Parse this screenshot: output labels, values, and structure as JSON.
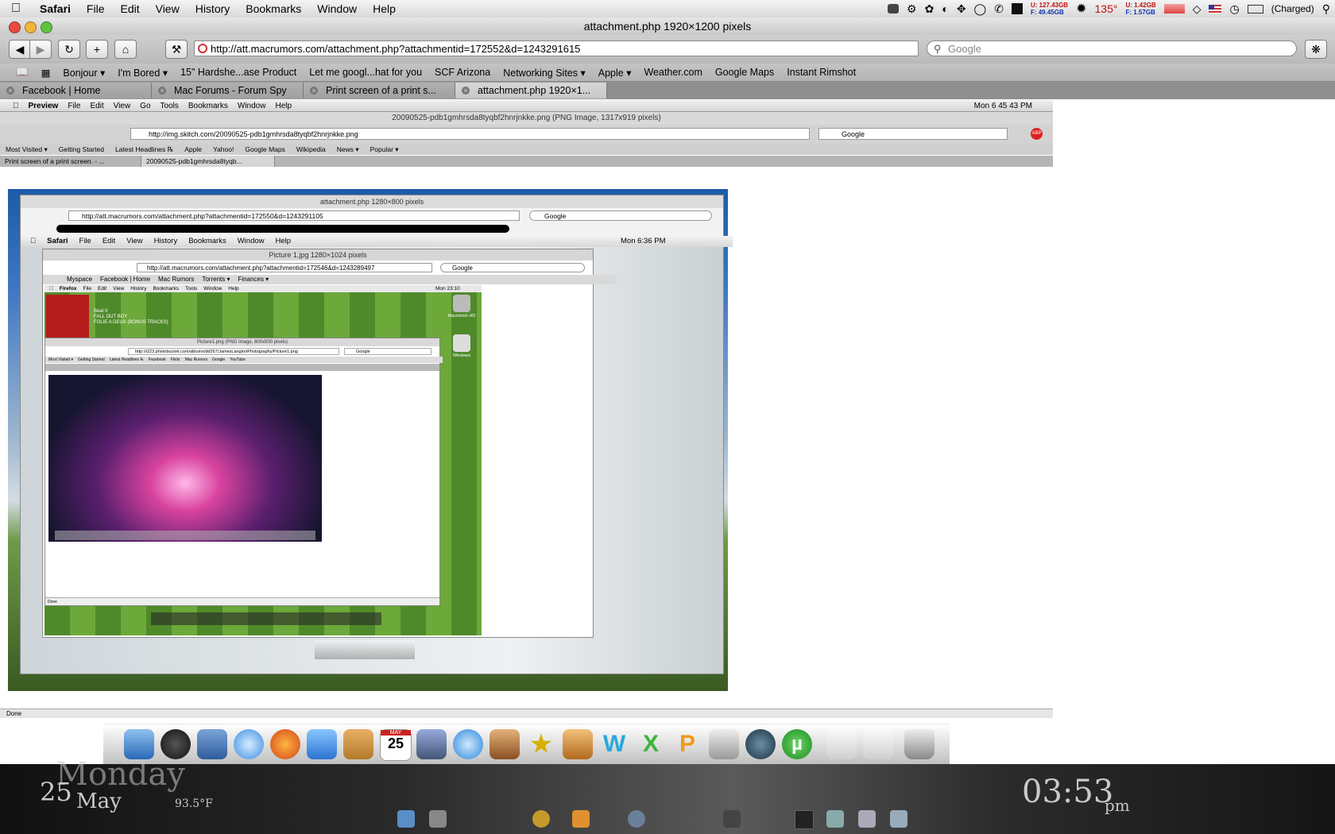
{
  "menubar": {
    "app": "Safari",
    "items": [
      "File",
      "Edit",
      "View",
      "History",
      "Bookmarks",
      "Window",
      "Help"
    ],
    "disk1": {
      "used": "U: 127.43GB",
      "free": "F: 49.45GB"
    },
    "temp": "135°",
    "disk2": {
      "used": "U: 1.42GB",
      "free": "F: 1.57GB"
    },
    "battery": "(Charged)"
  },
  "window": {
    "title": "attachment.php 1920×1200 pixels",
    "url": "http://att.macrumors.com/attachment.php?attachmentid=172552&d=1243291615",
    "search_placeholder": "Google"
  },
  "bookmarks": [
    "Bonjour ▾",
    "I'm Bored ▾",
    "15\" Hardshe...ase Product",
    "Let me googl...hat for you",
    "SCF Arizona",
    "Networking Sites ▾",
    "Apple ▾",
    "Weather.com",
    "Google Maps",
    "Instant Rimshot"
  ],
  "tabs": [
    {
      "label": "Facebook | Home",
      "active": false
    },
    {
      "label": "Mac Forums - Forum Spy",
      "active": false
    },
    {
      "label": "Print screen of a print s...",
      "active": false
    },
    {
      "label": "attachment.php 1920×1...",
      "active": true
    }
  ],
  "shot": {
    "menubar": {
      "app": "Preview",
      "items": [
        "File",
        "Edit",
        "View",
        "Go",
        "Tools",
        "Bookmarks",
        "Window",
        "Help"
      ],
      "clock": "Mon 6 45 43 PM"
    },
    "title": "20090525-pdb1gmhrsda8tyqbf2hnrjnkke.png (PNG Image, 1317x919 pixels)",
    "url": "http://img.skitch.com/20090525-pdb1gmhrsda8tyqbf2hnrjnkke.png",
    "search_placeholder": "Google",
    "bookmarks": [
      "Most Visited ▾",
      "Getting Started",
      "Latest Headlines ℞",
      "Apple",
      "Yahoo!",
      "Google Maps",
      "Wikipedia",
      "News ▾",
      "Popular ▾"
    ],
    "tabs": [
      "Print screen of a print screen. - ...",
      "20090525-pdb1gmhrsda8tyqb..."
    ],
    "status": "Done",
    "inner1": {
      "title": "attachment.php 1280×800 pixels",
      "url": "http://att.macrumors.com/attachment.php?attachmentid=172550&d=1243291105",
      "search": "Google",
      "menubar": {
        "app": "Safari",
        "items": [
          "File",
          "Edit",
          "View",
          "History",
          "Bookmarks",
          "Window",
          "Help"
        ],
        "clock": "Mon 6:36 PM"
      }
    },
    "inner2": {
      "title": "Picture 1.jpg 1280×1024 pixels",
      "url": "http://att.macrumors.com/attachment.php?attachmentid=172546&d=1243289497",
      "search": "Google",
      "bookmarks": [
        "Myspace",
        "Facebook | Home",
        "Mac Rumors",
        "Torrents ▾",
        "Finances ▾"
      ],
      "menubar": {
        "app": "Firefox",
        "items": [
          "File",
          "Edit",
          "View",
          "History",
          "Bookmarks",
          "Tools",
          "Window",
          "Help"
        ],
        "clock": "Mon 23:10"
      }
    },
    "inner3": {
      "title": "Picture1.png (PNG Image, 800x500 pixels)",
      "url": "http://i223.photobucket.com/albums/dd267/JamesLangtonPhotography/Picture1.png",
      "search": "Google",
      "bookmarks": [
        "Most Visited ▾",
        "Getting Started",
        "Latest Headlines ℞",
        "Facebook",
        "Flickr",
        "Mac Rumors",
        "Google",
        "YouTube"
      ],
      "status": "Done"
    },
    "itunes": {
      "title": "Beat It",
      "artist": "FALL OUT BOY",
      "album": "FOLIE A DEUX (BONUS TRACKS)"
    },
    "desktop_icons": [
      "Macintosh HD",
      "Windows"
    ]
  },
  "desktop": {
    "day": "Monday",
    "date_num": "25",
    "month": "May",
    "temp": "93.5°F",
    "time": "03:53",
    "ampm": "pm",
    "dock_calendar_day": "25",
    "dock_calendar_month": "MAY"
  }
}
